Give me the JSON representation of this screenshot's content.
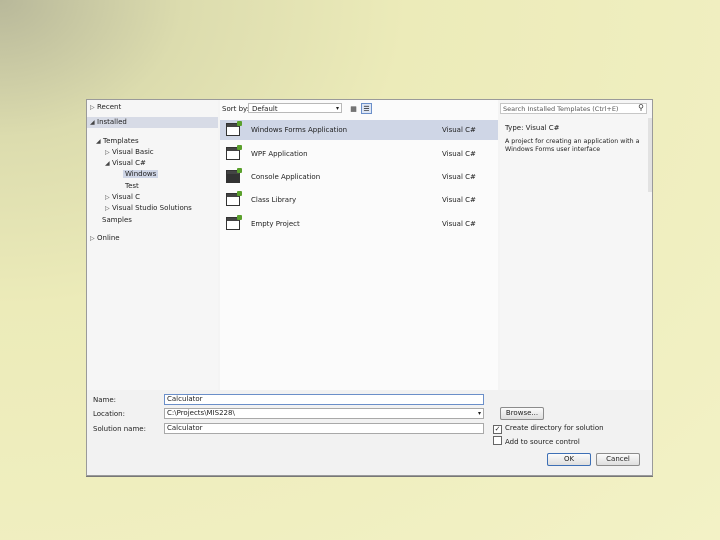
{
  "tree": {
    "recent": "Recent",
    "installed": "Installed",
    "templates": "Templates",
    "visual_basic": "Visual Basic",
    "visual_csharp": "Visual C#",
    "windows": "Windows",
    "test": "Test",
    "visual_c": "Visual C",
    "visual_studio_solutions": "Visual Studio Solutions",
    "samples": "Samples",
    "online": "Online"
  },
  "toolbar": {
    "sort_label": "Sort by:",
    "sort_value": "Default"
  },
  "templates": [
    {
      "name": "Windows Forms Application",
      "lang": "Visual C#",
      "selected": true
    },
    {
      "name": "WPF Application",
      "lang": "Visual C#",
      "selected": false
    },
    {
      "name": "Console Application",
      "lang": "Visual C#",
      "selected": false
    },
    {
      "name": "Class Library",
      "lang": "Visual C#",
      "selected": false
    },
    {
      "name": "Empty Project",
      "lang": "Visual C#",
      "selected": false
    }
  ],
  "details": {
    "search_placeholder": "Search Installed Templates (Ctrl+E)",
    "type_label": "Type:  Visual C#",
    "description": "A project for creating an application with a Windows Forms user interface"
  },
  "form": {
    "name_label": "Name:",
    "name_value": "Calculator",
    "location_label": "Location:",
    "location_value": "C:\\Projects\\MIS228\\",
    "solution_label": "Solution name:",
    "solution_value": "Calculator",
    "browse_label": "Browse...",
    "create_dir_label": "Create directory for solution",
    "source_control_label": "Add to source control",
    "ok_label": "OK",
    "cancel_label": "Cancel"
  }
}
